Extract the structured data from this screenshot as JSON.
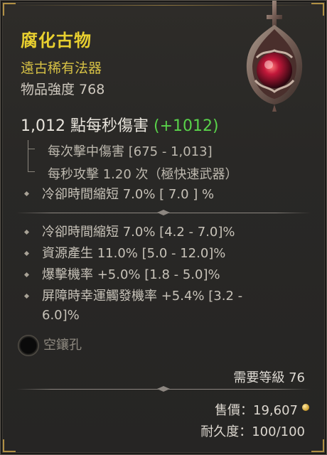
{
  "item": {
    "name": "腐化古物",
    "rarity": "遠古稀有法器",
    "power_label": "物品強度 768"
  },
  "weapon": {
    "dps_label": "1,012 點每秒傷害",
    "dps_gain": "(+1012)",
    "damage_per_hit": "每次擊中傷害 [675 - 1,013]",
    "attack_speed": "每秒攻擊 1.20 次（極快速武器）"
  },
  "implicit": {
    "text": "冷卻時間縮短 7.0% [ 7.0 ] %"
  },
  "affixes": [
    {
      "text": "冷卻時間縮短 7.0% [4.2 - 7.0]%"
    },
    {
      "text": "資源產生 11.0% [5.0 - 12.0]%"
    },
    {
      "text": "爆擊機率 +5.0% [1.8 - 5.0]%"
    },
    {
      "text": "屏障時幸運觸發機率 +5.4% [3.2 -"
    },
    {
      "text": "6.0]%"
    }
  ],
  "socket": {
    "label": "空鑲孔"
  },
  "requirements": {
    "level_label": "需要等級 76"
  },
  "footer": {
    "price_label": "售價：19,607",
    "durability_label": "耐久度：100/100"
  },
  "colors": {
    "legendary_yellow": "#e8cf2f",
    "gain_green": "#59d24a",
    "frame_gold": "#c9a24a"
  }
}
